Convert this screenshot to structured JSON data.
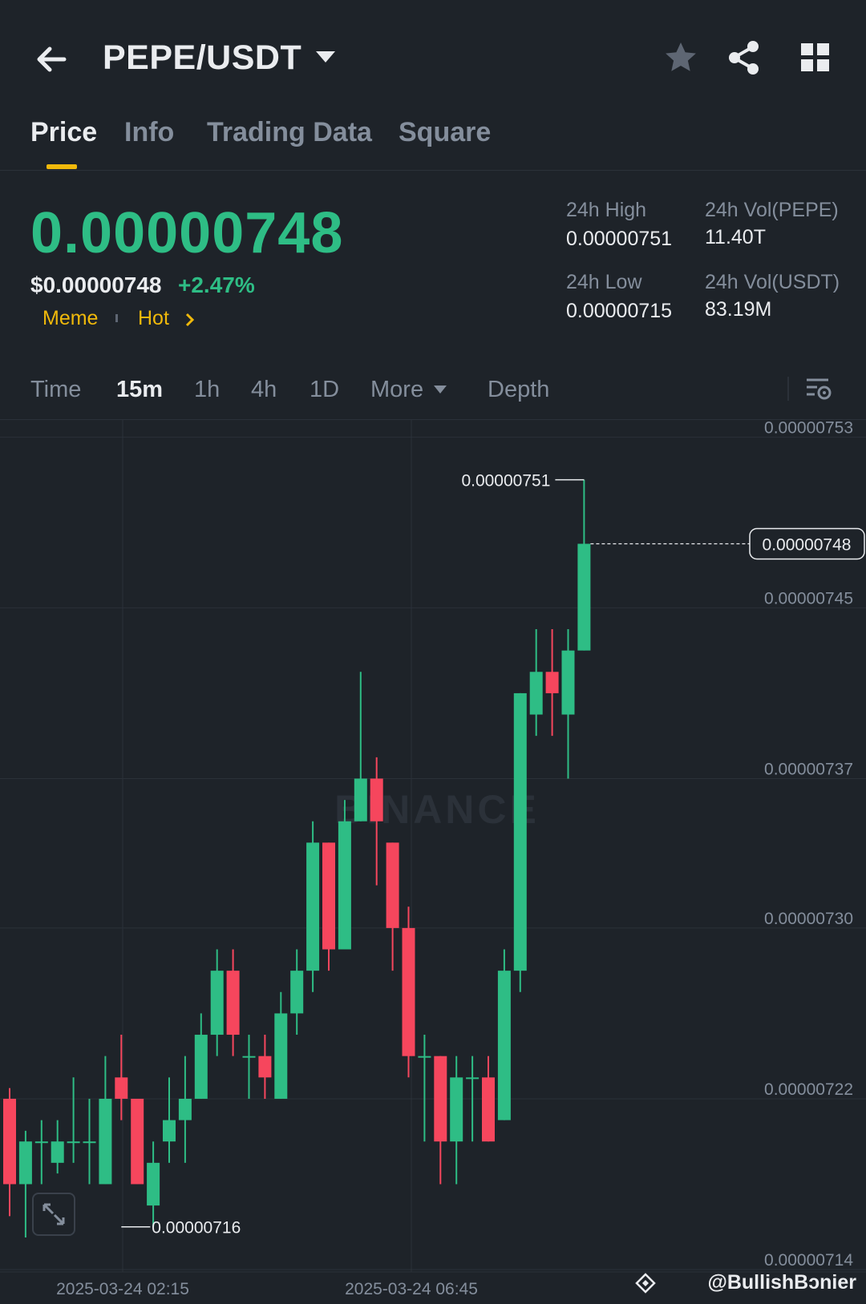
{
  "header": {
    "pair": "PEPE/USDT",
    "icons": [
      "back-arrow-icon",
      "dropdown-caret-icon",
      "star-icon",
      "share-icon",
      "grid-menu-icon"
    ]
  },
  "tabs": [
    {
      "label": "Price",
      "active": true
    },
    {
      "label": "Info",
      "active": false
    },
    {
      "label": "Trading Data",
      "active": false
    },
    {
      "label": "Square",
      "active": false
    }
  ],
  "ticker": {
    "last_price": "0.00000748",
    "usd_price": "$0.00000748",
    "change_pct": "+2.47%",
    "tags": [
      "Meme",
      "Hot"
    ],
    "high_label": "24h High",
    "high_value": "0.00000751",
    "low_label": "24h Low",
    "low_value": "0.00000715",
    "vol_base_label": "24h Vol(PEPE)",
    "vol_base_value": "11.40T",
    "vol_quote_label": "24h Vol(USDT)",
    "vol_quote_value": "83.19M"
  },
  "intervals": {
    "time": "Time",
    "options": [
      "15m",
      "1h",
      "4h",
      "1D"
    ],
    "selected": "15m",
    "more": "More",
    "depth": "Depth"
  },
  "colors": {
    "up": "#2ebd85",
    "down": "#f6465d",
    "accent": "#f0b90b",
    "background": "#1e2329"
  },
  "chart_data": {
    "type": "candlestick",
    "y_ticks": [
      "0.00000753",
      "0.00000745",
      "0.00000737",
      "0.00000730",
      "0.00000722",
      "0.00000714"
    ],
    "x_ticks": [
      "2025-03-24 02:15",
      "2025-03-24 06:45"
    ],
    "ylim": [
      7.137e-06,
      7.535e-06
    ],
    "high_marker": "0.00000751",
    "low_marker": "0.00000716",
    "last_price_label": "0.00000748",
    "watermark": "BINANCE",
    "candles": [
      {
        "o": 7.22,
        "c": 7.18,
        "h": 7.225,
        "l": 7.165
      },
      {
        "o": 7.18,
        "c": 7.2,
        "h": 7.205,
        "l": 7.155
      },
      {
        "o": 7.2,
        "c": 7.2,
        "h": 7.21,
        "l": 7.18
      },
      {
        "o": 7.19,
        "c": 7.2,
        "h": 7.21,
        "l": 7.185
      },
      {
        "o": 7.2,
        "c": 7.2,
        "h": 7.23,
        "l": 7.19
      },
      {
        "o": 7.2,
        "c": 7.2,
        "h": 7.22,
        "l": 7.18
      },
      {
        "o": 7.18,
        "c": 7.22,
        "h": 7.24,
        "l": 7.18
      },
      {
        "o": 7.23,
        "c": 7.22,
        "h": 7.25,
        "l": 7.21
      },
      {
        "o": 7.22,
        "c": 7.18,
        "h": 7.22,
        "l": 7.18
      },
      {
        "o": 7.17,
        "c": 7.19,
        "h": 7.2,
        "l": 7.16
      },
      {
        "o": 7.2,
        "c": 7.21,
        "h": 7.23,
        "l": 7.19
      },
      {
        "o": 7.21,
        "c": 7.22,
        "h": 7.24,
        "l": 7.19
      },
      {
        "o": 7.22,
        "c": 7.25,
        "h": 7.26,
        "l": 7.22
      },
      {
        "o": 7.25,
        "c": 7.28,
        "h": 7.29,
        "l": 7.24
      },
      {
        "o": 7.28,
        "c": 7.25,
        "h": 7.29,
        "l": 7.24
      },
      {
        "o": 7.24,
        "c": 7.24,
        "h": 7.25,
        "l": 7.22
      },
      {
        "o": 7.24,
        "c": 7.23,
        "h": 7.25,
        "l": 7.22
      },
      {
        "o": 7.22,
        "c": 7.26,
        "h": 7.27,
        "l": 7.22
      },
      {
        "o": 7.26,
        "c": 7.28,
        "h": 7.29,
        "l": 7.25
      },
      {
        "o": 7.28,
        "c": 7.34,
        "h": 7.35,
        "l": 7.27
      },
      {
        "o": 7.34,
        "c": 7.29,
        "h": 7.34,
        "l": 7.28
      },
      {
        "o": 7.29,
        "c": 7.35,
        "h": 7.36,
        "l": 7.29
      },
      {
        "o": 7.35,
        "c": 7.37,
        "h": 7.42,
        "l": 7.35
      },
      {
        "o": 7.37,
        "c": 7.35,
        "h": 7.38,
        "l": 7.32
      },
      {
        "o": 7.34,
        "c": 7.3,
        "h": 7.34,
        "l": 7.28
      },
      {
        "o": 7.3,
        "c": 7.24,
        "h": 7.31,
        "l": 7.23
      },
      {
        "o": 7.24,
        "c": 7.24,
        "h": 7.25,
        "l": 7.2
      },
      {
        "o": 7.24,
        "c": 7.2,
        "h": 7.24,
        "l": 7.18
      },
      {
        "o": 7.2,
        "c": 7.23,
        "h": 7.24,
        "l": 7.18
      },
      {
        "o": 7.23,
        "c": 7.23,
        "h": 7.24,
        "l": 7.2
      },
      {
        "o": 7.23,
        "c": 7.2,
        "h": 7.24,
        "l": 7.2
      },
      {
        "o": 7.21,
        "c": 7.28,
        "h": 7.29,
        "l": 7.21
      },
      {
        "o": 7.28,
        "c": 7.41,
        "h": 7.41,
        "l": 7.27
      },
      {
        "o": 7.4,
        "c": 7.42,
        "h": 7.44,
        "l": 7.39
      },
      {
        "o": 7.42,
        "c": 7.41,
        "h": 7.44,
        "l": 7.39
      },
      {
        "o": 7.4,
        "c": 7.43,
        "h": 7.44,
        "l": 7.37
      },
      {
        "o": 7.43,
        "c": 7.48,
        "h": 7.51,
        "l": 7.43
      }
    ]
  },
  "footer": {
    "watermark_handle": "@BullishBɔnier"
  }
}
